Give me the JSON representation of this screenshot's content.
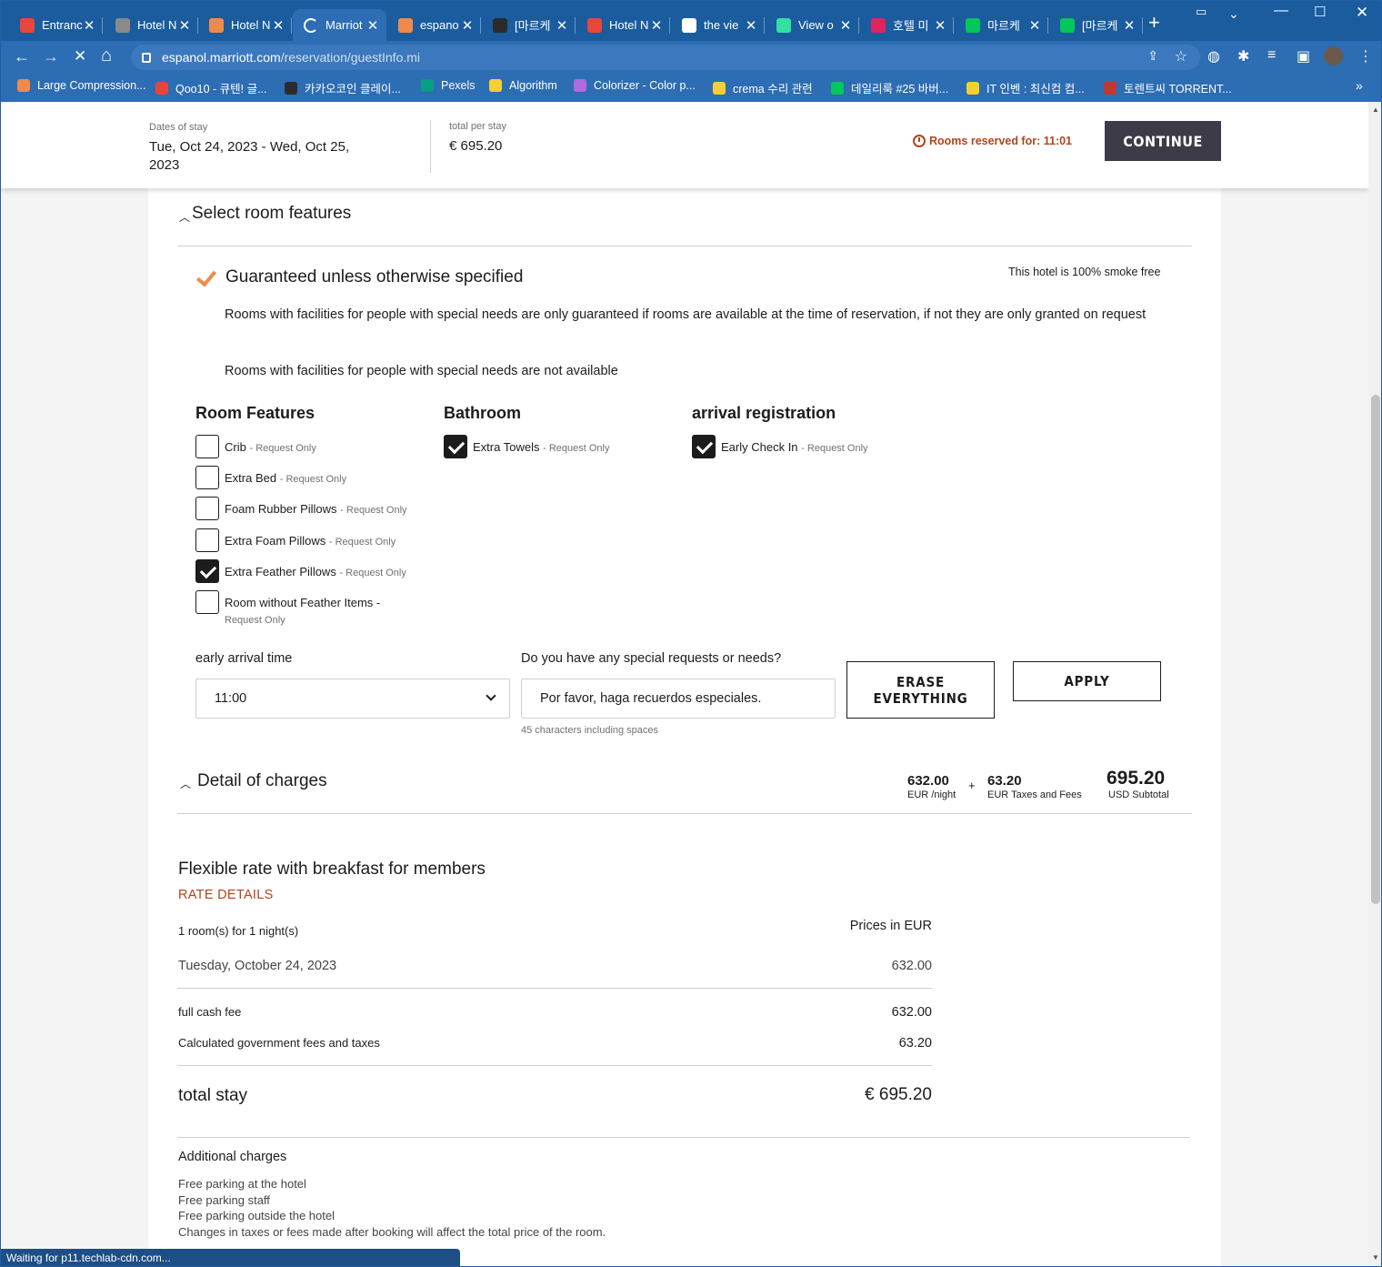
{
  "browser": {
    "tabs": [
      {
        "title": "Entranc",
        "color": "#e8453c",
        "icon": "maps-pin-icon"
      },
      {
        "title": "Hotel N",
        "color": "#8a8a8a",
        "icon": "hotel-icon"
      },
      {
        "title": "Hotel N",
        "color": "#f08a4b",
        "icon": "circle-icon"
      },
      {
        "title": "Marriot",
        "color": "#2d6db3",
        "icon": "loading-icon",
        "active": true
      },
      {
        "title": "espano",
        "color": "#f08a4b",
        "icon": "circle-icon"
      },
      {
        "title": "[마르케",
        "color": "#2b2b2b",
        "icon": "quill-icon"
      },
      {
        "title": "Hotel N",
        "color": "#e8453c",
        "icon": "maps-pin-icon"
      },
      {
        "title": "the vie",
        "color": "#ffffff",
        "icon": "google-icon"
      },
      {
        "title": "View o",
        "color": "#34e0a1",
        "icon": "tripadvisor-icon"
      },
      {
        "title": "호텔 미",
        "color": "#e0245e",
        "icon": "app-icon"
      },
      {
        "title": "마르케",
        "color": "#03c75a",
        "icon": "naver-icon"
      },
      {
        "title": "[마르케",
        "color": "#03c75a",
        "icon": "blog-icon"
      }
    ],
    "url_host": "espanol.marriott.com",
    "url_path": "/reservation/guestInfo.mi",
    "bookmarks": [
      {
        "label": "Large Compression...",
        "color": "#f08a4b"
      },
      {
        "label": "Qoo10 - 큐텐! 글...",
        "color": "#e8453c"
      },
      {
        "label": "카카오코인 클레이...",
        "color": "#2b2b2b"
      },
      {
        "label": "Pexels",
        "color": "#05a081"
      },
      {
        "label": "Algorithm",
        "color": "#f5d033"
      },
      {
        "label": "Colorizer - Color p...",
        "color": "#b06adf"
      },
      {
        "label": "crema 수리 관련",
        "color": "#f5d033"
      },
      {
        "label": "데일리룩 #25 바버...",
        "color": "#03c75a"
      },
      {
        "label": "IT 인벤 : 최신컴 컴...",
        "color": "#f5d033"
      },
      {
        "label": "토렌트씨 TORRENT...",
        "color": "#c0392b"
      }
    ],
    "status": "Waiting for p11.techlab-cdn.com..."
  },
  "header": {
    "dates_label": "Dates of stay",
    "dates_line1": "Tue, Oct 24, 2023 - Wed, Oct 25,",
    "dates_line2": "2023",
    "total_label": "total per stay",
    "total_value": "€ 695.20",
    "reserved": "Rooms reserved for: 11:01",
    "continue": "CONTINUE"
  },
  "features": {
    "section_title": "Select room features",
    "guaranteed": "Guaranteed unless otherwise specified",
    "smoke": "This hotel is 100% smoke free",
    "para1": "Rooms with facilities for people with special needs are only guaranteed if rooms are available at the time of reservation, if not they are only granted on request",
    "para2": "Rooms with facilities for people with special needs are not available",
    "col1_title": "Room Features",
    "col2_title": "Bathroom",
    "col3_title": "arrival registration",
    "request_only": "- Request Only",
    "room_items": [
      {
        "label": "Crib",
        "checked": false
      },
      {
        "label": "Extra Bed",
        "checked": false
      },
      {
        "label": "Foam Rubber Pillows",
        "checked": false
      },
      {
        "label": "Extra Foam Pillows",
        "checked": false
      },
      {
        "label": "Extra Feather Pillows",
        "checked": true
      },
      {
        "label": "Room without Feather Items -",
        "checked": false
      }
    ],
    "room_item_6_req": "Request Only",
    "bath_items": [
      {
        "label": "Extra Towels",
        "checked": true
      }
    ],
    "arrival_items": [
      {
        "label": "Early Check In",
        "checked": true
      }
    ],
    "arrival_time_label": "early arrival time",
    "arrival_time_value": "11:00",
    "requests_label": "Do you have any special requests or needs?",
    "requests_value": "Por favor, haga recuerdos especiales.",
    "requests_hint": "45 characters including spaces",
    "erase_line1": "ERASE",
    "erase_line2": "EVERYTHING",
    "apply": "APPLY"
  },
  "charges": {
    "section_title": "Detail of charges",
    "night_value": "632.00",
    "night_label": "EUR /night",
    "plus": "+",
    "tax_value": "63.20",
    "tax_label": "EUR Taxes and Fees",
    "subtotal_value": "695.20",
    "subtotal_label": "USD Subtotal",
    "rate_title": "Flexible rate with breakfast for members",
    "rate_link": "RATE DETAILS",
    "rooms_nights": "1 room(s) for 1 night(s)",
    "prices_in": "Prices in EUR",
    "date_row_label": "Tuesday, October 24, 2023",
    "date_row_value": "632.00",
    "cash_label": "full cash fee",
    "cash_value": "632.00",
    "gov_label": "Calculated government fees and taxes",
    "gov_value": "63.20",
    "total_label": "total stay",
    "total_value": "€ 695.20",
    "additional_title": "Additional charges",
    "additional": [
      "Free parking at the hotel",
      "Free parking staff",
      "Free parking outside the hotel",
      "Changes in taxes or fees made after booking will affect the total price of the room."
    ]
  }
}
